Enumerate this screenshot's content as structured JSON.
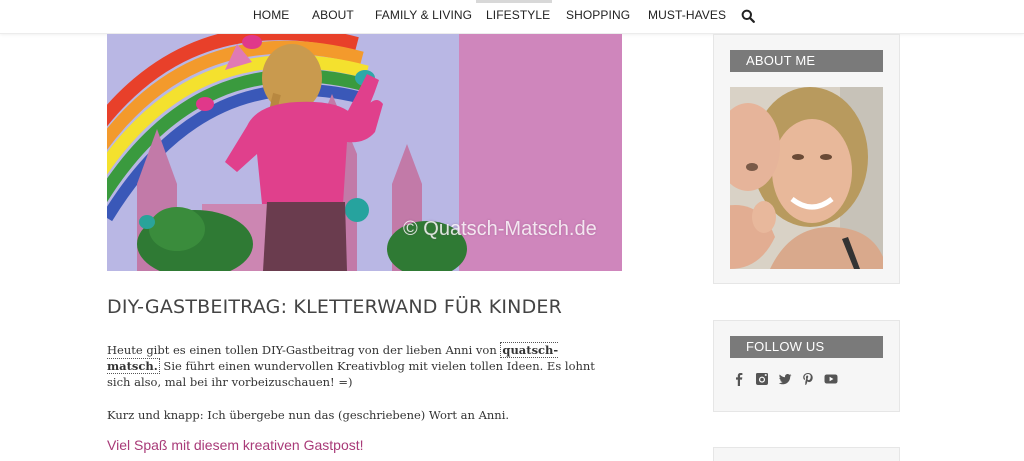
{
  "nav": {
    "items": [
      {
        "label": "HOME"
      },
      {
        "label": "ABOUT"
      },
      {
        "label": "FAMILY & LIVING"
      },
      {
        "label": "LIFESTYLE"
      },
      {
        "label": "SHOPPING"
      },
      {
        "label": "MUST-HAVES"
      }
    ],
    "search_icon": "search-icon",
    "active_item": "LIFESTYLE"
  },
  "hero": {
    "watermark": "© Quatsch-Matsch.de"
  },
  "post": {
    "title": "DIY-GASTBEITRAG: KLETTERWAND FÜR KINDER",
    "para1_before": "Heute gibt es einen tollen DIY-Gastbeitrag von der lieben Anni von ",
    "para1_link": "quatsch-matsch.",
    "para1_after": " Sie führt einen wundervollen Kreativblog mit vielen tollen Ideen. Es lohnt sich also, mal bei ihr vorbeizuschauen! =)",
    "para2": "Kurz und knapp: Ich übergebe nun das (geschriebene) Wort an Anni.",
    "highlight": "Viel Spaß mit diesem kreativen Gastpost!"
  },
  "sidebar": {
    "about": {
      "title": "ABOUT ME"
    },
    "follow": {
      "title": "FOLLOW US",
      "icons": [
        "facebook-icon",
        "instagram-icon",
        "twitter-icon",
        "pinterest-icon",
        "youtube-icon"
      ]
    }
  },
  "colors": {
    "accent": "#a83a78",
    "widget_title_bg": "#7a7a7a",
    "widget_bg": "#f6f6f6"
  }
}
